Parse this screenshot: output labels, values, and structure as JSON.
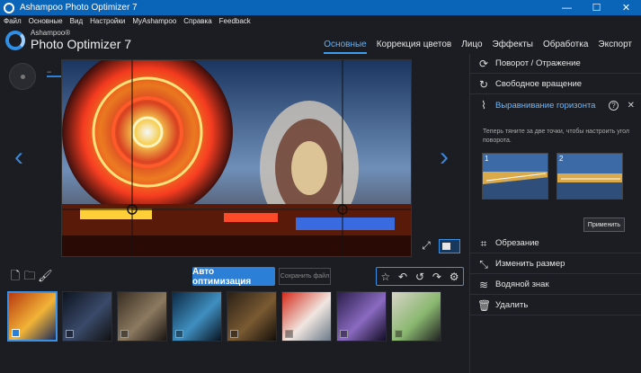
{
  "window": {
    "title": "Ashampoo Photo Optimizer 7",
    "minimize": "—",
    "maximize": "☐",
    "close": "✕"
  },
  "menu": [
    "Файл",
    "Основные",
    "Вид",
    "Настройки",
    "MyAshampoo",
    "Справка",
    "Feedback"
  ],
  "logo": {
    "brand": "Ashampoo®",
    "product": "Photo Optimizer 7"
  },
  "tabs": [
    {
      "label": "Основные",
      "active": true
    },
    {
      "label": "Коррекция цветов",
      "active": false
    },
    {
      "label": "Лицо",
      "active": false
    },
    {
      "label": "Эффекты",
      "active": false
    },
    {
      "label": "Обработка",
      "active": false
    },
    {
      "label": "Экспорт",
      "active": false
    }
  ],
  "viewer": {
    "zoom_minus": "−",
    "zoom_plus": "+",
    "zoom_level": 0.35,
    "prev_arrow": "‹",
    "next_arrow": "›",
    "fullscreen_glyph": "⤢"
  },
  "toolbar": {
    "auto_optimize": "Авто оптимизация",
    "save_file": "Сохранить файл"
  },
  "panel": {
    "rotate_flip": "Поворот / Отражение",
    "free_rotate": "Свободное вращение",
    "horizon": "Выравнивание горизонта",
    "help": "?",
    "close": "✕",
    "hint": "Теперь тяните за две точки, чтобы настроить угол поворота.",
    "step1": "1",
    "step2": "2",
    "apply": "Применить",
    "crop": "Обрезание",
    "resize": "Изменить размер",
    "watermark": "Водяной знак",
    "delete": "Удалить"
  },
  "thumbnails": [
    {
      "selected": true,
      "colors": [
        "#b83a10",
        "#f2b437",
        "#1a2a5a"
      ]
    },
    {
      "selected": false,
      "colors": [
        "#0e1420",
        "#3a4a6a",
        "#111111"
      ]
    },
    {
      "selected": false,
      "colors": [
        "#3a2e22",
        "#8c7a60",
        "#1a1512"
      ]
    },
    {
      "selected": false,
      "colors": [
        "#0d2a44",
        "#3f8fc0",
        "#081420"
      ]
    },
    {
      "selected": false,
      "colors": [
        "#2a2016",
        "#7a5a32",
        "#140f0a"
      ]
    },
    {
      "selected": false,
      "colors": [
        "#d42a1a",
        "#f0e6e0",
        "#6a7a8a"
      ]
    },
    {
      "selected": false,
      "colors": [
        "#2a1e4a",
        "#8a6ac0",
        "#120c24"
      ]
    },
    {
      "selected": false,
      "colors": [
        "#d8d4c8",
        "#8ab870",
        "#202020"
      ]
    }
  ],
  "accent": "#2c7fd6"
}
